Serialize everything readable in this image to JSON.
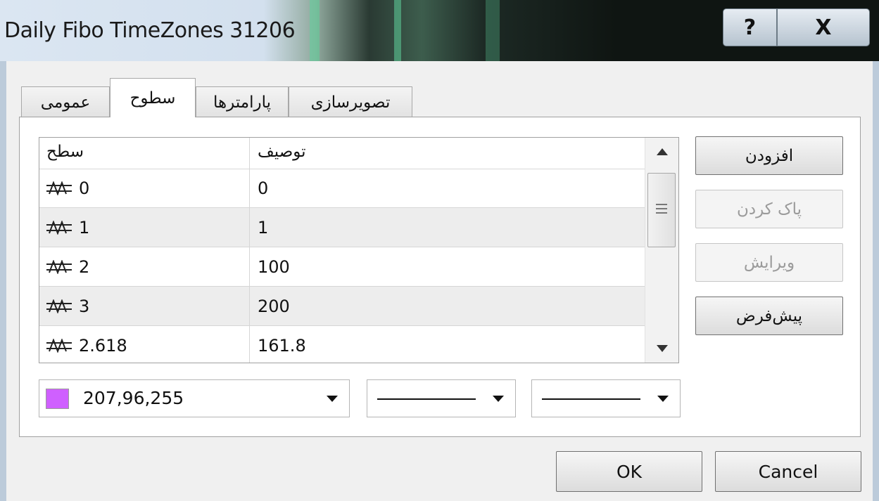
{
  "window": {
    "title": "Daily Fibo TimeZones 31206",
    "help_label": "?",
    "close_label": "X"
  },
  "tabs": [
    {
      "label": "عمومی"
    },
    {
      "label": "سطوح",
      "active": true
    },
    {
      "label": "پارامترها"
    },
    {
      "label": "تصویرسازی"
    }
  ],
  "levels_table": {
    "columns": [
      "سطح",
      "توصیف"
    ],
    "rows": [
      {
        "level": "0",
        "description": "0"
      },
      {
        "level": "1",
        "description": "1"
      },
      {
        "level": "2",
        "description": "100"
      },
      {
        "level": "3",
        "description": "200"
      },
      {
        "level": "2.618",
        "description": "161.8"
      }
    ]
  },
  "actions": {
    "add": "افزودن",
    "delete": "پاک کردن",
    "edit": "ویرایش",
    "default": "پیش‌فرض"
  },
  "style": {
    "color_value": "207,96,255",
    "color_hex": "#cf60ff"
  },
  "dialog_buttons": {
    "ok": "OK",
    "cancel": "Cancel"
  }
}
